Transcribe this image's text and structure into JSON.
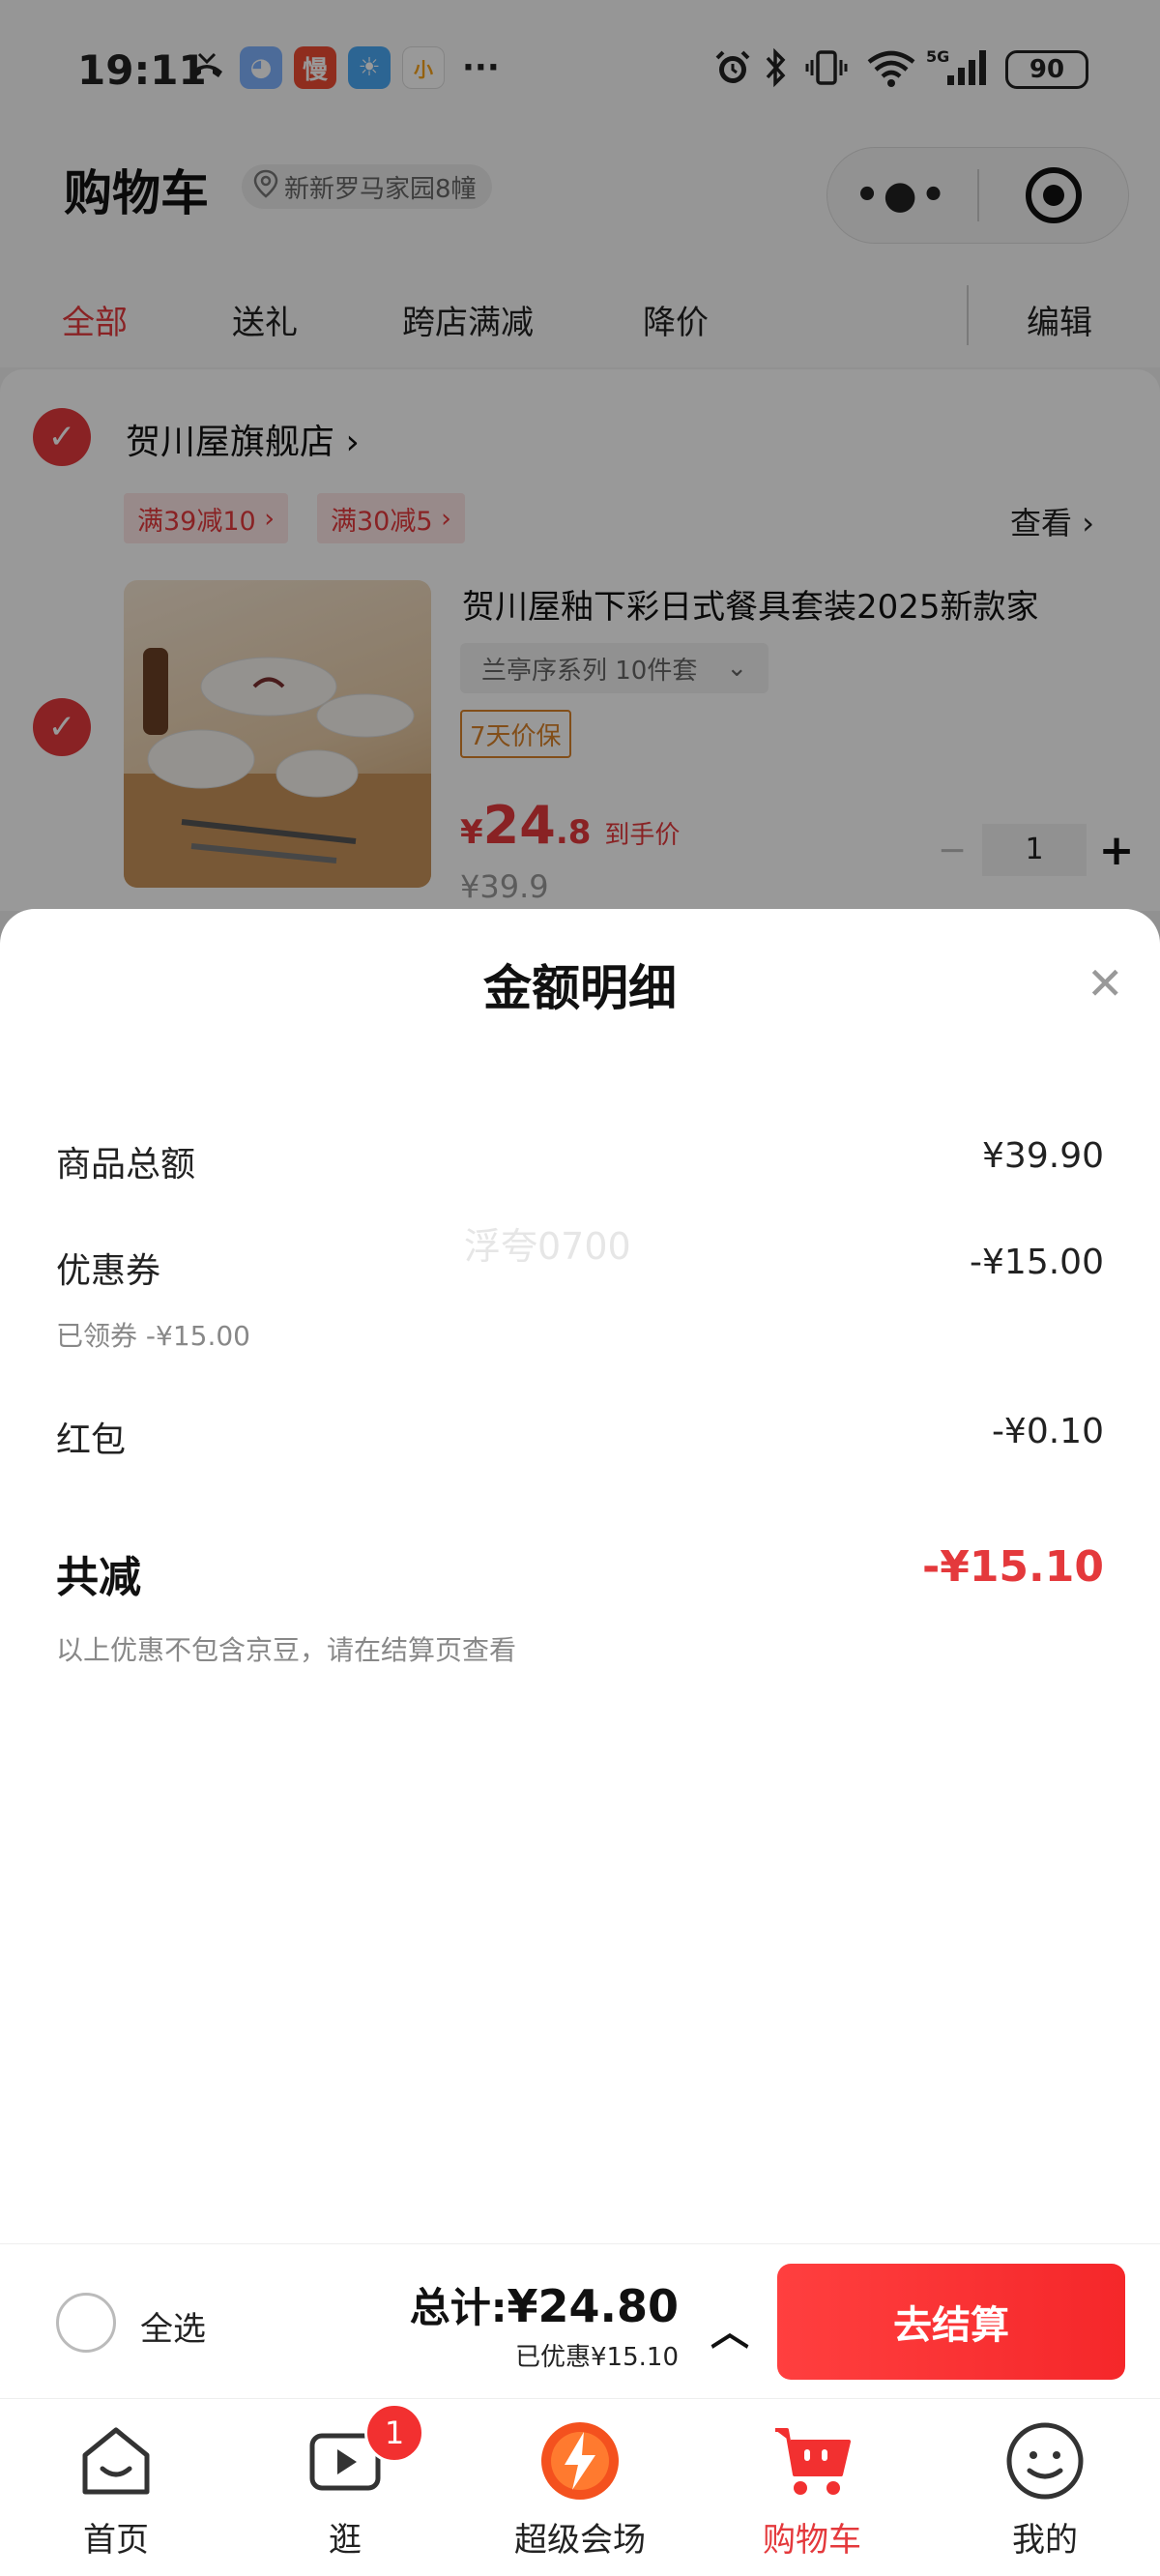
{
  "status_bar": {
    "time": "19:11",
    "app_icons": [
      {
        "name": "ai-assistant-icon",
        "glyph": "◕",
        "color": "#7fb2ff"
      },
      {
        "name": "man-app-icon",
        "glyph": "慢",
        "color": "#ee4b33"
      },
      {
        "name": "weather-icon",
        "glyph": "☀",
        "color": "#4aa8f5"
      },
      {
        "name": "xiaomao-icon",
        "glyph": "小",
        "color": "#f7a21a"
      }
    ],
    "more": "···",
    "battery": "90"
  },
  "header": {
    "title": "购物车",
    "location": "新新罗马家园8幢"
  },
  "tabs": {
    "all": "全部",
    "gift": "送礼",
    "cross_store": "跨店满减",
    "price_drop": "降价",
    "edit": "编辑"
  },
  "store": {
    "name": "贺川屋旗舰店",
    "promos": [
      "满39减10",
      "满30减5"
    ],
    "view": "查看"
  },
  "product": {
    "title": "贺川屋釉下彩日式餐具套装2025新款家",
    "spec": "兰亭序系列 10件套",
    "guarantee": "7天价保",
    "price_yen": "¥",
    "price_int": "24",
    "price_dec": ".8",
    "price_note": "到手价",
    "price_original": "¥39.9",
    "quantity": "1"
  },
  "sheet": {
    "title": "金额明细",
    "watermark": "浮夸0700",
    "rows": [
      {
        "label": "商品总额",
        "value": "¥39.90"
      },
      {
        "label": "优惠券",
        "value": "-¥15.00",
        "sub": "已领券 -¥15.00"
      },
      {
        "label": "红包",
        "value": "-¥0.10"
      }
    ],
    "total_label": "共减",
    "total_value": "-¥15.10",
    "footnote": "以上优惠不包含京豆，请在结算页查看"
  },
  "checkout": {
    "select_all": "全选",
    "sum_label": "总计:",
    "sum_value": "¥24.80",
    "saved": "已优惠¥15.10",
    "pay_button": "去结算"
  },
  "tabbar": {
    "items": [
      {
        "label": "首页"
      },
      {
        "label": "逛",
        "badge": "1"
      },
      {
        "label": "超级会场"
      },
      {
        "label": "购物车"
      },
      {
        "label": "我的"
      }
    ]
  },
  "colors": {
    "accent": "#e4393c",
    "pay_button": "#f5272a"
  }
}
